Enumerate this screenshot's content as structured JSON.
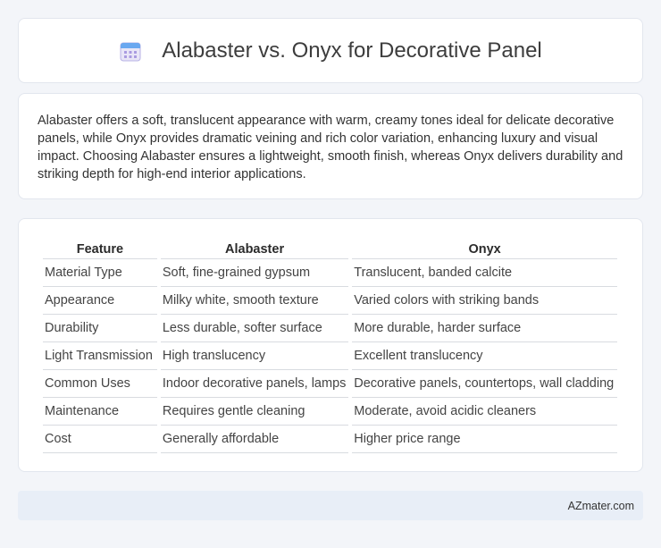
{
  "header": {
    "title": "Alabaster vs. Onyx for Decorative Panel",
    "icon": "calendar-icon"
  },
  "summary": {
    "text": "Alabaster offers a soft, translucent appearance with warm, creamy tones ideal for delicate decorative panels, while Onyx provides dramatic veining and rich color variation, enhancing luxury and visual impact. Choosing Alabaster ensures a lightweight, smooth finish, whereas Onyx delivers durability and striking depth for high-end interior applications."
  },
  "table": {
    "headers": [
      "Feature",
      "Alabaster",
      "Onyx"
    ],
    "rows": [
      [
        "Material Type",
        "Soft, fine-grained gypsum",
        "Translucent, banded calcite"
      ],
      [
        "Appearance",
        "Milky white, smooth texture",
        "Varied colors with striking bands"
      ],
      [
        "Durability",
        "Less durable, softer surface",
        "More durable, harder surface"
      ],
      [
        "Light Transmission",
        "High translucency",
        "Excellent translucency"
      ],
      [
        "Common Uses",
        "Indoor decorative panels, lamps",
        "Decorative panels, countertops, wall cladding"
      ],
      [
        "Maintenance",
        "Requires gentle cleaning",
        "Moderate, avoid acidic cleaners"
      ],
      [
        "Cost",
        "Generally affordable",
        "Higher price range"
      ]
    ]
  },
  "footer": {
    "text": "AZmater.com"
  }
}
